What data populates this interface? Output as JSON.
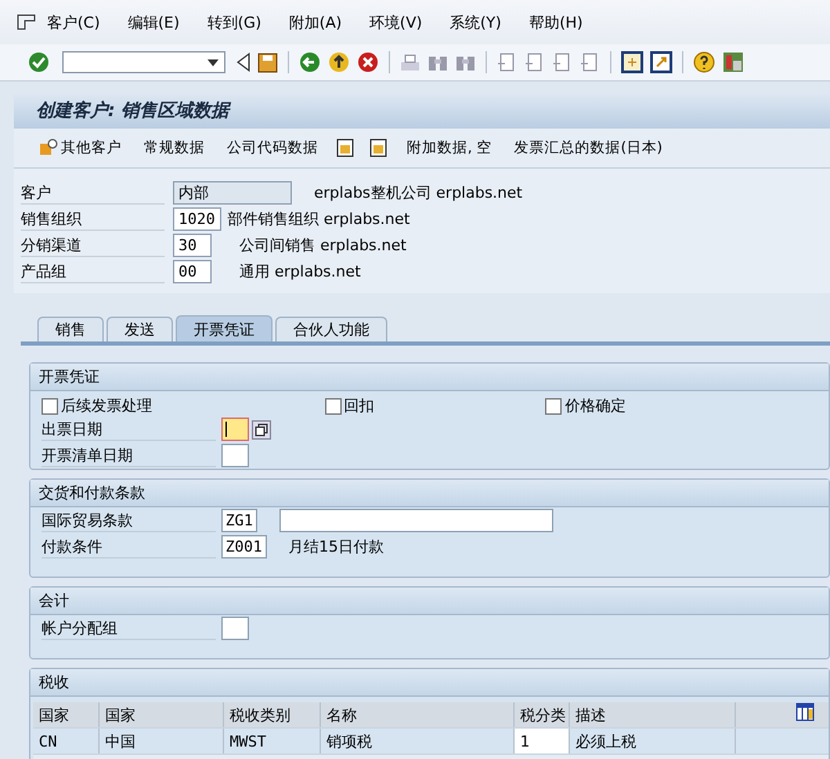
{
  "menu": [
    "客户(C)",
    "编辑(E)",
    "转到(G)",
    "附加(A)",
    "环境(V)",
    "系统(Y)",
    "帮助(H)"
  ],
  "title": "创建客户: 销售区域数据",
  "app_toolbar": [
    {
      "kind": "button",
      "label": "其他客户"
    },
    {
      "kind": "button",
      "label": "常规数据"
    },
    {
      "kind": "button",
      "label": "公司代码数据"
    },
    {
      "kind": "icon"
    },
    {
      "kind": "icon"
    },
    {
      "kind": "button",
      "label": "附加数据, 空"
    },
    {
      "kind": "button",
      "label": "发票汇总的数据(日本)"
    }
  ],
  "header": [
    {
      "label": "客户",
      "value": "内部",
      "readonly": true,
      "description": "erplabs整机公司 erplabs.net"
    },
    {
      "label": "销售组织",
      "value": "1020",
      "readonly": false,
      "description": "部件销售组织 erplabs.net"
    },
    {
      "label": "分销渠道",
      "value": "30",
      "readonly": false,
      "description": "公司间销售 erplabs.net"
    },
    {
      "label": "产品组",
      "value": "00",
      "readonly": false,
      "description": "通用 erplabs.net"
    }
  ],
  "tabs": [
    {
      "label": "销售",
      "selected": false
    },
    {
      "label": "发送",
      "selected": false
    },
    {
      "label": "开票凭证",
      "selected": true
    },
    {
      "label": "合伙人功能",
      "selected": false
    }
  ],
  "invoicing": {
    "title": "开票凭证",
    "checkboxes": [
      {
        "label": "后续发票处理",
        "checked": false
      },
      {
        "label": "回扣",
        "checked": false
      },
      {
        "label": "价格确定",
        "checked": false
      }
    ],
    "fields": [
      {
        "label": "出票日期",
        "focused": true
      },
      {
        "label": "开票清单日期",
        "focused": false
      }
    ]
  },
  "delivery": {
    "title": "交货和付款条款",
    "fields": [
      {
        "label": "国际贸易条款",
        "value": "ZG1",
        "extra_input": true
      },
      {
        "label": "付款条件",
        "value": "Z001",
        "description": "月结15日付款"
      }
    ]
  },
  "accounting": {
    "title": "会计",
    "fields": [
      {
        "label": "帐户分配组"
      }
    ]
  },
  "taxes": {
    "title": "税收",
    "columns": [
      "国家",
      "国家",
      "税收类别",
      "名称",
      "税分类",
      "描述"
    ],
    "rows": [
      [
        "CN",
        "中国",
        "MWST",
        "销项税",
        "1",
        "必须上税"
      ]
    ]
  }
}
